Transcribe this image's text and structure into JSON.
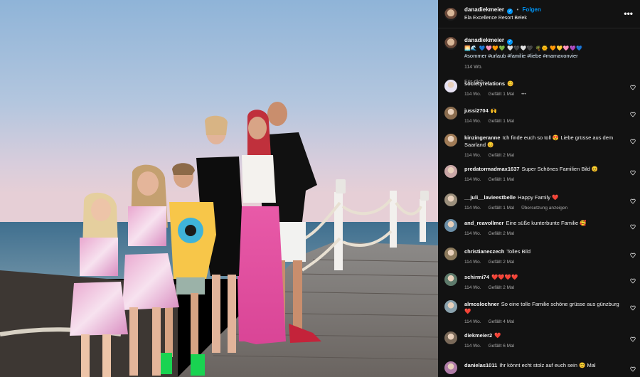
{
  "header": {
    "username": "danadiekmeier",
    "verified_mark": "✓",
    "separator": "•",
    "follow_label": "Folgen",
    "location": "Ela Excellence Resort Belek",
    "more_label": "•••"
  },
  "caption": {
    "username": "danadiekmeier",
    "emoji_line": "🌅🌊 💙🩷🧡💚 🤍🖤🤍🖤 🌴🌞 🧡💛🩷💜💙",
    "hashtags": "#sommer #urlaub #familie #liebe #mamavonvier",
    "time": "114 Wo."
  },
  "sort_label": "Für dich ⌵",
  "comments": [
    {
      "name": "societyrelations",
      "text": "😊",
      "time": "114 Wo.",
      "likes": "Gefällt 1 Mal",
      "extra": "•••",
      "color": "#e7e2f3"
    },
    {
      "name": "jussi2704",
      "text": "🙌",
      "time": "114 Wo.",
      "likes": "Gefällt 1 Mal",
      "extra": "",
      "color": "#8b6d4f"
    },
    {
      "name": "kinzingeranne",
      "text": "Ich finde euch so toll 😍 Liebe grüsse aus dem Saarland 😊",
      "time": "114 Wo.",
      "likes": "Gefällt 2 Mal",
      "extra": "",
      "color": "#a07b56"
    },
    {
      "name": "predatormadmax1637",
      "text": "Super Schönes Familien Bild 😊",
      "time": "114 Wo.",
      "likes": "Gefällt 1 Mal",
      "extra": "",
      "color": "#c9a6a6"
    },
    {
      "name": "__juli__lavieestbelle",
      "text": "Happy Family ❤️",
      "time": "114 Wo.",
      "likes": "Gefällt 1 Mal",
      "extra": "Übersetzung anzeigen",
      "color": "#9b8f7c"
    },
    {
      "name": "and_reavollmer",
      "text": "Eine süße kunterbunte Familie 🥰",
      "time": "114 Wo.",
      "likes": "Gefällt 2 Mal",
      "extra": "",
      "color": "#6c8fa8"
    },
    {
      "name": "christianeczech",
      "text": "Tolles Bild",
      "time": "114 Wo.",
      "likes": "Gefällt 2 Mal",
      "extra": "",
      "color": "#8c7a5c"
    },
    {
      "name": "schirmi74",
      "text": "❤️❤️❤️❤️",
      "time": "114 Wo.",
      "likes": "Gefällt 2 Mal",
      "extra": "",
      "color": "#5d7a6b"
    },
    {
      "name": "almoslochner",
      "text": "So eine tolle Familie schöne grüsse aus günzburg ❤️",
      "time": "114 Wo.",
      "likes": "Gefällt 4 Mal",
      "extra": "",
      "color": "#8aa2ad"
    },
    {
      "name": "diekmeier2",
      "text": "❤️",
      "time": "114 Wo.",
      "likes": "Gefällt 6 Mal",
      "extra": "",
      "color": "#7a6a5a"
    },
    {
      "name": "danielas1011",
      "text": "Ihr könnt echt stolz auf euch sein 😊 Mal",
      "time": "",
      "likes": "",
      "extra": "",
      "color": "#b07da8"
    }
  ],
  "colors": {
    "accent": "#0095f6",
    "sidebar_bg": "#121212",
    "secondary_text": "#a8a8a8"
  }
}
